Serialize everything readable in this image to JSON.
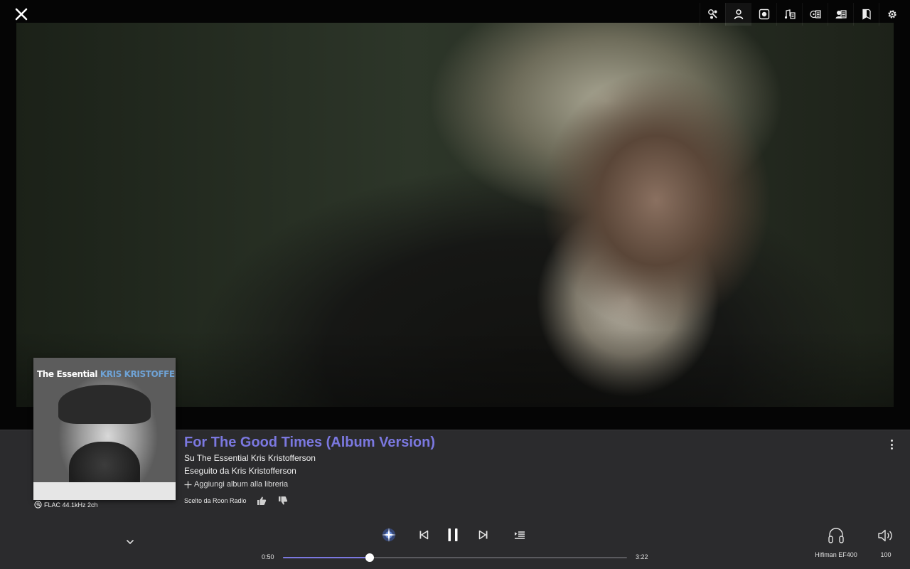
{
  "toolbar": {
    "close_label": "✕",
    "tools": [
      {
        "name": "production-credits-icon"
      },
      {
        "name": "artist-icon",
        "active": true
      },
      {
        "name": "album-icon"
      },
      {
        "name": "lyrics-icon"
      },
      {
        "name": "album-review-icon"
      },
      {
        "name": "artist-bio-icon"
      },
      {
        "name": "bookmark-icon"
      },
      {
        "name": "settings-icon"
      }
    ]
  },
  "album_art": {
    "line1": "The Essential",
    "line2": "KRIS KRISTOFFERSON"
  },
  "track": {
    "title": "For The Good Times (Album Version)",
    "album_line": "Su The Essential Kris Kristofferson",
    "artist_line": "Eseguito da Kris Kristofferson",
    "add_library": "Aggiungi album alla libreria",
    "radio_label": "Scelto da Roon Radio",
    "format": "FLAC 44.1kHz 2ch"
  },
  "playback": {
    "elapsed": "0:50",
    "total": "3:22",
    "progress_fraction": 0.2525
  },
  "zone": {
    "device": "Hifiman EF400",
    "volume": "100"
  },
  "colors": {
    "accent": "#7b78e0",
    "bar_background": "#2b2b2d"
  }
}
